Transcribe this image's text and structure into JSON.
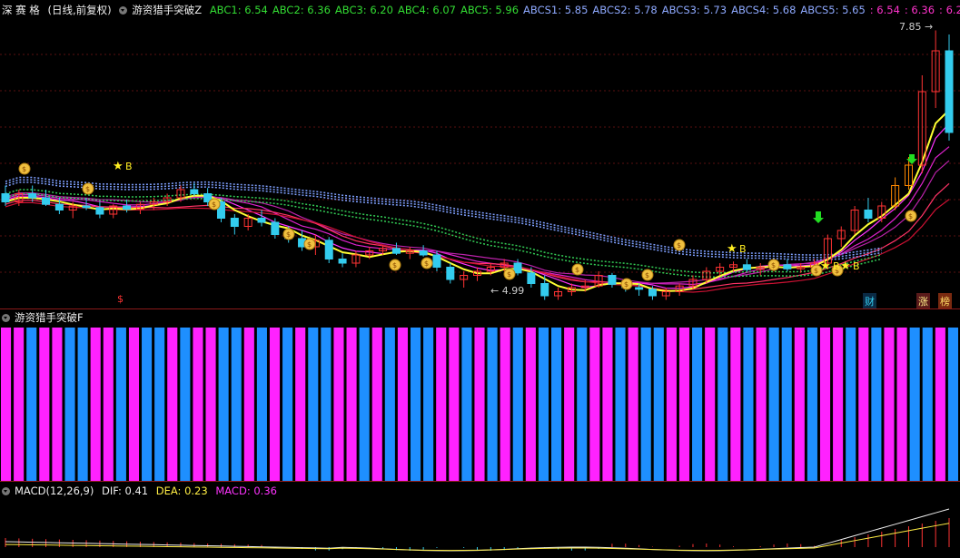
{
  "main_header": {
    "stock_name": "深 赛 格",
    "period": "(日线,前复权)",
    "indicator_name": "游资猎手突破Z",
    "values": [
      {
        "label": "ABC1: 6.54",
        "color": "#33dd33"
      },
      {
        "label": "ABC2: 6.36",
        "color": "#33dd33"
      },
      {
        "label": "ABC3: 6.20",
        "color": "#33dd33"
      },
      {
        "label": "ABC4: 6.07",
        "color": "#33dd33"
      },
      {
        "label": "ABC5: 5.96",
        "color": "#33dd33"
      },
      {
        "label": "ABCS1: 5.85",
        "color": "#8ea9ff"
      },
      {
        "label": "ABCS2: 5.78",
        "color": "#8ea9ff"
      },
      {
        "label": "ABCS3: 5.73",
        "color": "#8ea9ff"
      },
      {
        "label": "ABCS4: 5.68",
        "color": "#8ea9ff"
      },
      {
        "label": "ABCS5: 5.65",
        "color": "#8ea9ff"
      },
      {
        "label": ": 6.54",
        "color": "#ff33cc"
      },
      {
        "label": ": 6.36",
        "color": "#ff33cc"
      },
      {
        "label": ": 6.20",
        "color": "#ff33cc"
      },
      {
        "label": ": 6.(",
        "color": "#ff33cc"
      }
    ]
  },
  "price_labels": {
    "high": "7.85",
    "low": "4.99"
  },
  "markers": {
    "buy": "B",
    "finance": "财",
    "rise": "涨",
    "hot": "榜",
    "s_mark": "$"
  },
  "indicator_header": {
    "name": "游资猎手突破F"
  },
  "macd_header": {
    "name": "MACD(12,26,9)",
    "dif": "DIF: 0.41",
    "dea": "DEA: 0.23",
    "macd": "MACD: 0.36"
  },
  "colors": {
    "up": "#ff3333",
    "down": "#33ccee",
    "pink": "#ff22ff",
    "blue": "#1e8fff",
    "yellow": "#ffff33",
    "orange": "#ff8800"
  },
  "chart_data": {
    "type": "candlestick",
    "price_range": [
      4.5,
      8.0
    ],
    "candles_ohlc": [
      [
        5.85,
        5.95,
        5.7,
        5.75
      ],
      [
        5.75,
        5.9,
        5.7,
        5.85
      ],
      [
        5.85,
        5.95,
        5.75,
        5.8
      ],
      [
        5.8,
        5.9,
        5.7,
        5.72
      ],
      [
        5.72,
        5.8,
        5.6,
        5.65
      ],
      [
        5.65,
        5.75,
        5.55,
        5.7
      ],
      [
        5.7,
        5.8,
        5.65,
        5.68
      ],
      [
        5.68,
        5.75,
        5.55,
        5.6
      ],
      [
        5.6,
        5.72,
        5.55,
        5.7
      ],
      [
        5.7,
        5.78,
        5.62,
        5.66
      ],
      [
        5.66,
        5.75,
        5.6,
        5.72
      ],
      [
        5.72,
        5.8,
        5.65,
        5.75
      ],
      [
        5.75,
        5.85,
        5.7,
        5.8
      ],
      [
        5.8,
        5.95,
        5.75,
        5.9
      ],
      [
        5.9,
        5.98,
        5.82,
        5.85
      ],
      [
        5.85,
        5.92,
        5.7,
        5.75
      ],
      [
        5.75,
        5.8,
        5.5,
        5.55
      ],
      [
        5.55,
        5.6,
        5.35,
        5.45
      ],
      [
        5.45,
        5.6,
        5.4,
        5.55
      ],
      [
        5.55,
        5.65,
        5.45,
        5.5
      ],
      [
        5.5,
        5.55,
        5.3,
        5.35
      ],
      [
        5.35,
        5.45,
        5.25,
        5.3
      ],
      [
        5.3,
        5.4,
        5.15,
        5.2
      ],
      [
        5.2,
        5.35,
        5.1,
        5.28
      ],
      [
        5.28,
        5.32,
        5.0,
        5.05
      ],
      [
        5.05,
        5.12,
        4.95,
        5.0
      ],
      [
        5.0,
        5.15,
        4.95,
        5.1
      ],
      [
        5.1,
        5.2,
        5.05,
        5.15
      ],
      [
        5.15,
        5.22,
        5.1,
        5.18
      ],
      [
        5.18,
        5.25,
        5.1,
        5.12
      ],
      [
        5.12,
        5.2,
        5.05,
        5.15
      ],
      [
        5.15,
        5.22,
        5.08,
        5.1
      ],
      [
        5.1,
        5.15,
        4.9,
        4.95
      ],
      [
        4.95,
        5.0,
        4.75,
        4.8
      ],
      [
        4.8,
        4.9,
        4.7,
        4.85
      ],
      [
        4.85,
        4.95,
        4.78,
        4.9
      ],
      [
        4.9,
        5.0,
        4.85,
        4.95
      ],
      [
        4.95,
        5.05,
        4.9,
        5.0
      ],
      [
        5.0,
        5.05,
        4.85,
        4.88
      ],
      [
        4.88,
        4.95,
        4.7,
        4.75
      ],
      [
        4.75,
        4.85,
        4.55,
        4.6
      ],
      [
        4.6,
        4.7,
        4.55,
        4.65
      ],
      [
        4.65,
        4.75,
        4.6,
        4.7
      ],
      [
        4.7,
        4.8,
        4.65,
        4.72
      ],
      [
        4.72,
        4.9,
        4.7,
        4.85
      ],
      [
        4.85,
        4.88,
        4.7,
        4.74
      ],
      [
        4.74,
        4.8,
        4.65,
        4.7
      ],
      [
        4.7,
        4.75,
        4.6,
        4.68
      ],
      [
        4.68,
        4.72,
        4.55,
        4.6
      ],
      [
        4.6,
        4.7,
        4.55,
        4.65
      ],
      [
        4.65,
        4.75,
        4.6,
        4.72
      ],
      [
        4.72,
        4.85,
        4.68,
        4.8
      ],
      [
        4.8,
        4.95,
        4.75,
        4.9
      ],
      [
        4.9,
        5.0,
        4.85,
        4.95
      ],
      [
        4.95,
        5.02,
        4.9,
        4.98
      ],
      [
        4.98,
        5.05,
        4.9,
        4.92
      ],
      [
        4.92,
        5.0,
        4.85,
        4.95
      ],
      [
        4.95,
        5.02,
        4.9,
        4.98
      ],
      [
        4.98,
        5.05,
        4.9,
        4.93
      ],
      [
        4.93,
        5.0,
        4.88,
        4.95
      ],
      [
        4.95,
        5.05,
        4.9,
        5.0
      ],
      [
        5.0,
        5.35,
        4.95,
        5.3
      ],
      [
        5.3,
        5.45,
        5.2,
        5.4
      ],
      [
        5.4,
        5.7,
        5.35,
        5.65
      ],
      [
        5.65,
        5.8,
        5.5,
        5.55
      ],
      [
        5.55,
        5.75,
        5.5,
        5.7
      ],
      [
        5.7,
        6.05,
        5.65,
        5.95
      ],
      [
        5.95,
        6.3,
        5.9,
        6.2
      ],
      [
        6.2,
        7.3,
        6.1,
        7.1
      ],
      [
        7.1,
        7.85,
        6.9,
        7.6
      ],
      [
        7.6,
        7.8,
        6.5,
        6.6
      ]
    ]
  }
}
